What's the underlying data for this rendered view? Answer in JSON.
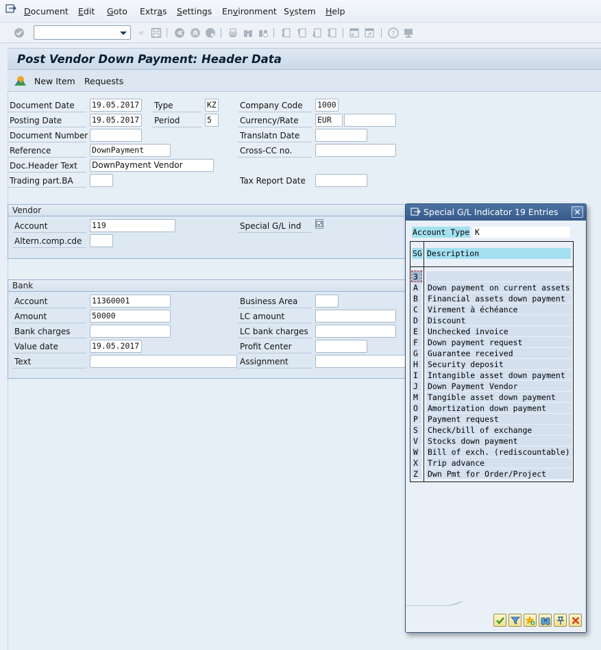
{
  "menubar": {
    "items": [
      {
        "label": "Document",
        "hotkey_index": 0
      },
      {
        "label": "Edit",
        "hotkey_index": 0
      },
      {
        "label": "Goto",
        "hotkey_index": 0
      },
      {
        "label": "Extras",
        "hotkey_index": 4
      },
      {
        "label": "Settings",
        "hotkey_index": 0
      },
      {
        "label": "Environment",
        "hotkey_index": 2
      },
      {
        "label": "System",
        "hotkey_index": 1
      },
      {
        "label": "Help",
        "hotkey_index": 0
      }
    ]
  },
  "toolbar": {
    "command_field": {
      "value": "",
      "placeholder": ""
    },
    "icons": [
      "enter-icon",
      "back-icon",
      "save-icon",
      "exit-icon",
      "up-icon",
      "cancel-icon",
      "print-icon",
      "find-icon",
      "find-next-icon",
      "first-page-icon",
      "previous-page-icon",
      "next-page-icon",
      "last-page-icon",
      "new-session-icon",
      "shortcut-icon",
      "help-icon",
      "layout-icon"
    ]
  },
  "header": {
    "title": "Post Vendor Down Payment: Header Data"
  },
  "app_toolbar": {
    "new_item": "New Item",
    "requests": "Requests"
  },
  "header_data": {
    "document_date": {
      "label": "Document Date",
      "value": "19.05.2017"
    },
    "type": {
      "label": "Type",
      "value": "KZ"
    },
    "company_code": {
      "label": "Company Code",
      "value": "1000"
    },
    "posting_date": {
      "label": "Posting Date",
      "value": "19.05.2017"
    },
    "period": {
      "label": "Period",
      "value": "5"
    },
    "currency_rate": {
      "label": "Currency/Rate",
      "currency": "EUR",
      "rate": ""
    },
    "document_number": {
      "label": "Document Number",
      "value": ""
    },
    "translatn_date": {
      "label": "Translatn Date",
      "value": ""
    },
    "reference": {
      "label": "Reference",
      "value": "DownPayment"
    },
    "cross_cc": {
      "label": "Cross-CC no.",
      "value": ""
    },
    "doc_header_text": {
      "label": "Doc.Header Text",
      "value": "DownPayment Vendor"
    },
    "trading_part": {
      "label": "Trading part.BA",
      "value": ""
    },
    "tax_report_date": {
      "label": "Tax Report Date",
      "value": ""
    }
  },
  "vendor": {
    "group_title": "Vendor",
    "account": {
      "label": "Account",
      "value": "119"
    },
    "special_gl": {
      "label": "Special G/L ind",
      "value": ""
    },
    "altern_comp": {
      "label": "Altern.comp.cde",
      "value": ""
    }
  },
  "bank": {
    "group_title": "Bank",
    "account": {
      "label": "Account",
      "value": "11360001"
    },
    "business_area": {
      "label": "Business Area",
      "value": ""
    },
    "amount": {
      "label": "Amount",
      "value": "50000"
    },
    "lc_amount": {
      "label": "LC amount",
      "value": ""
    },
    "bank_charges": {
      "label": "Bank charges",
      "value": ""
    },
    "lc_bank_charges": {
      "label": "LC bank charges",
      "value": ""
    },
    "value_date": {
      "label": "Value date",
      "value": "19.05.2017"
    },
    "profit_center": {
      "label": "Profit Center",
      "value": ""
    },
    "text": {
      "label": "Text",
      "value": ""
    },
    "assignment": {
      "label": "Assignment",
      "value": ""
    }
  },
  "dialog": {
    "title": "Special G/L Indicator 19 Entries",
    "account_type_label": "Account Type",
    "account_type_value": "K",
    "columns": {
      "sg": "SG",
      "description": "Description"
    },
    "rows": [
      {
        "sg": "3",
        "desc": "",
        "selected": true
      },
      {
        "sg": "A",
        "desc": "Down payment on current assets"
      },
      {
        "sg": "B",
        "desc": "Financial assets down payment"
      },
      {
        "sg": "C",
        "desc": "Virement à échéance"
      },
      {
        "sg": "D",
        "desc": "Discount"
      },
      {
        "sg": "E",
        "desc": "Unchecked invoice"
      },
      {
        "sg": "F",
        "desc": "Down payment request"
      },
      {
        "sg": "G",
        "desc": "Guarantee received"
      },
      {
        "sg": "H",
        "desc": "Security deposit"
      },
      {
        "sg": "I",
        "desc": "Intangible asset down payment"
      },
      {
        "sg": "J",
        "desc": "Down Payment Vendor"
      },
      {
        "sg": "M",
        "desc": "Tangible asset down payment"
      },
      {
        "sg": "O",
        "desc": "Amortization down payment"
      },
      {
        "sg": "P",
        "desc": "Payment request"
      },
      {
        "sg": "S",
        "desc": "Check/bill of exchange"
      },
      {
        "sg": "V",
        "desc": "Stocks down payment"
      },
      {
        "sg": "W",
        "desc": "Bill of exch. (rediscountable)"
      },
      {
        "sg": "X",
        "desc": "Trip advance"
      },
      {
        "sg": "Z",
        "desc": "Dwn Pmt for Order/Project"
      }
    ],
    "footer_buttons": [
      "copy-icon",
      "filter-icon",
      "favorite-add-icon",
      "find-icon",
      "pin-icon",
      "cancel-icon"
    ]
  }
}
